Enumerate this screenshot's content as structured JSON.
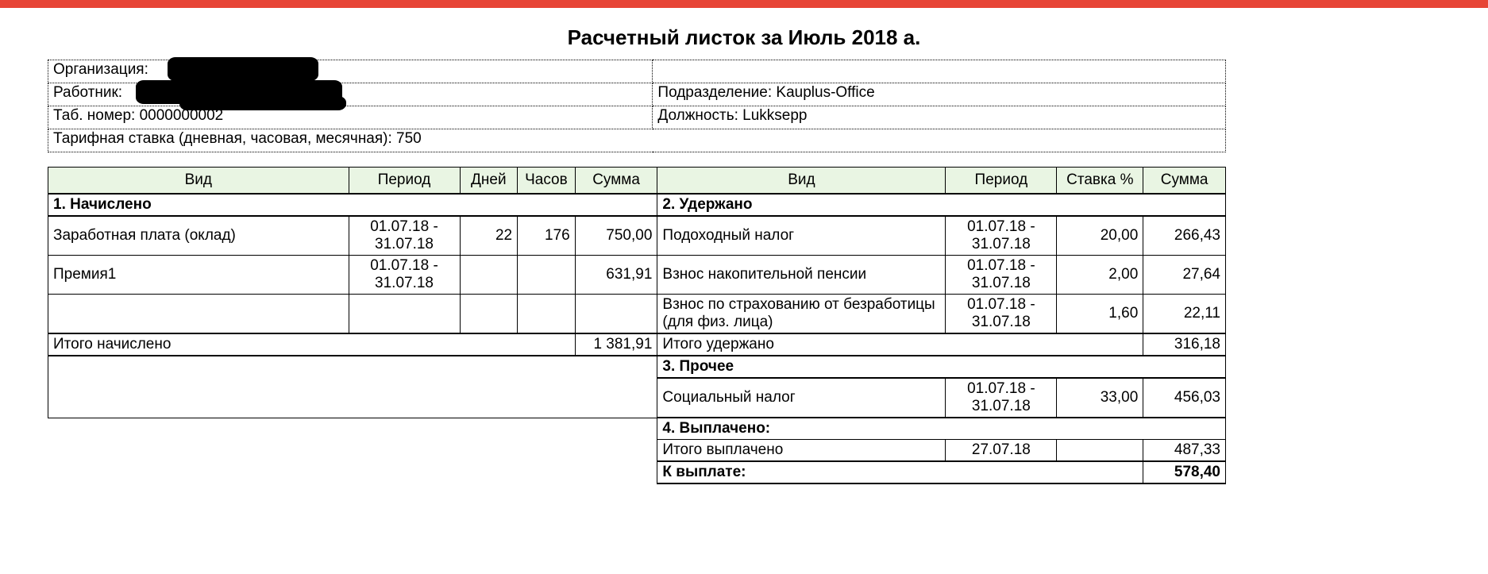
{
  "title": "Расчетный листок за Июль 2018 а.",
  "info": {
    "org_label": "Организация:",
    "emp_label": "Работник:",
    "tab_label": "Таб. номер: 0000000002",
    "rate_label": "Тарифная ставка (дневная, часовая, месячная): 750",
    "dept_label": "Подразделение: Kauplus-Office",
    "pos_label": "Должность: Lukksepp"
  },
  "headers": {
    "vid": "Вид",
    "period": "Период",
    "days": "Дней",
    "hours": "Часов",
    "sum": "Сумма",
    "rate": "Ставка %"
  },
  "sections": {
    "accrued": "1. Начислено",
    "withheld": "2. Удержано",
    "other": "3. Прочее",
    "paid": "4. Выплачено:",
    "to_pay": "К выплате:"
  },
  "accrued": [
    {
      "name": "Заработная плата (оклад)",
      "period": "01.07.18 - 31.07.18",
      "days": "22",
      "hours": "176",
      "sum": "750,00"
    },
    {
      "name": "Премия1",
      "period": "01.07.18 - 31.07.18",
      "days": "",
      "hours": "",
      "sum": "631,91"
    }
  ],
  "accrued_total": {
    "label": "Итого начислено",
    "sum": "1 381,91"
  },
  "withheld": [
    {
      "name": "Подоходный налог",
      "period": "01.07.18 - 31.07.18",
      "rate": "20,00",
      "sum": "266,43"
    },
    {
      "name": "Взнос накопительной пенсии",
      "period": "01.07.18 - 31.07.18",
      "rate": "2,00",
      "sum": "27,64"
    },
    {
      "name": "Взнос по страхованию от безработицы (для физ. лица)",
      "period": "01.07.18 - 31.07.18",
      "rate": "1,60",
      "sum": "22,11"
    }
  ],
  "withheld_total": {
    "label": "Итого удержано",
    "sum": "316,18"
  },
  "other": [
    {
      "name": "Социальный налог",
      "period": "01.07.18 - 31.07.18",
      "rate": "33,00",
      "sum": "456,03"
    }
  ],
  "paid": [
    {
      "name": "Итого выплачено",
      "period": "27.07.18",
      "rate": "",
      "sum": "487,33"
    }
  ],
  "to_pay_sum": "578,40"
}
